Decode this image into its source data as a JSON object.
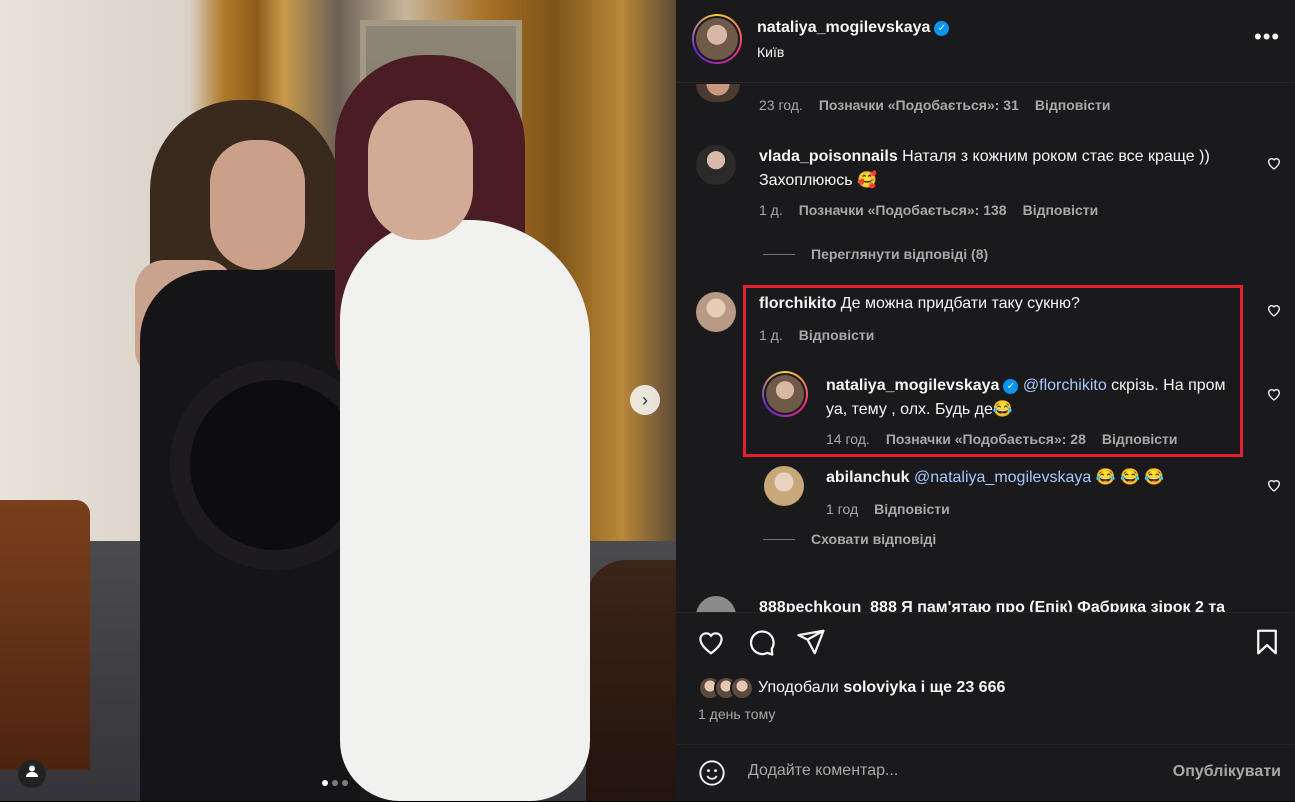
{
  "post": {
    "username": "nataliya_mogilevskaya",
    "location": "Київ",
    "more_label": "•••",
    "carousel_next": "›"
  },
  "comments": [
    {
      "meta_time": "23 год.",
      "meta_likes": "Позначки «Подобається»: 31",
      "meta_reply": "Відповісти"
    },
    {
      "username": "vlada_poisonnails",
      "text": "Наталя з кожним роком стає все краще )) Захоплююсь 🥰",
      "meta_time": "1 д.",
      "meta_likes": "Позначки «Подобається»: 138",
      "meta_reply": "Відповісти",
      "view_replies": "Переглянути відповіді (8)"
    },
    {
      "username": "florchikito",
      "text": "Де можна придбати таку сукню?",
      "meta_time": "1 д.",
      "meta_reply": "Відповісти"
    }
  ],
  "replies": [
    {
      "username": "nataliya_mogilevskaya",
      "mention": "@florchikito",
      "text": " скрізь. На пром уа, тему , олх. Будь де😂",
      "meta_time": "14 год.",
      "meta_likes": "Позначки «Подобається»: 28",
      "meta_reply": "Відповісти"
    },
    {
      "username": "abilanchuk",
      "mention": "@nataliya_mogilevskaya",
      "text": " 😂 😂 😂",
      "meta_time": "1 год",
      "meta_reply": "Відповісти"
    }
  ],
  "hide_replies": "Сховати відповіді",
  "next_comment_partial": "888pechkoun_888 Я пам'ятаю про (Епік) Фабрика зірок 2 та",
  "likes": {
    "prefix": "Уподобали ",
    "user": "soloviyka",
    "suffix": " і ще 23 666"
  },
  "post_time": "1 день тому",
  "composer": {
    "placeholder": "Додайте коментар...",
    "post_label": "Опублікувати"
  },
  "colors": {
    "panel_bg": "#1a1a1c",
    "highlight": "#e3202c",
    "verified": "#0095f6"
  }
}
